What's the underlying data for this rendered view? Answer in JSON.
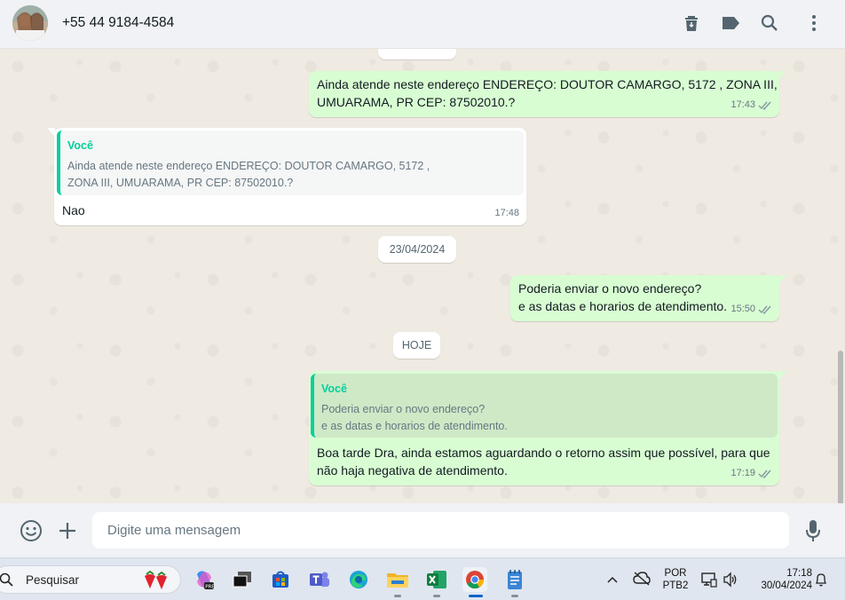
{
  "header": {
    "contact_name": "+55 44 9184-4584",
    "icons": [
      "delete-icon",
      "label-icon",
      "search-icon",
      "menu-icon"
    ]
  },
  "messages": {
    "msg1": {
      "text_line1": "Ainda atende neste endereço ENDEREÇO: DOUTOR CAMARGO, 5172 , ZONA III,",
      "text_line2": "UMUARAMA, PR CEP: 87502010.?",
      "time": "17:43"
    },
    "msg2": {
      "quote_author": "Você",
      "quote_line1": "Ainda atende neste endereço ENDEREÇO: DOUTOR CAMARGO, 5172 ,",
      "quote_line2": "ZONA III, UMUARAMA, PR CEP: 87502010.?",
      "text": "Nao",
      "time": "17:48"
    },
    "date1": "23/04/2024",
    "msg3": {
      "text_line1": "Poderia enviar o novo endereço?",
      "text_line2": "e as datas e horarios de atendimento.",
      "time": "15:50"
    },
    "date2": "HOJE",
    "msg4": {
      "quote_author": "Você",
      "quote_line1": "Poderia enviar o novo endereço?",
      "quote_line2": "e as datas e horarios de atendimento.",
      "text_line1": "Boa tarde Dra, ainda estamos aguardando o retorno assim que possível, para que",
      "text_line2": "não haja negativa de atendimento.",
      "time": "17:19"
    }
  },
  "composer": {
    "placeholder": "Digite uma mensagem"
  },
  "taskbar": {
    "search_label": "Pesquisar",
    "language_line1": "POR",
    "language_line2": "PTB2",
    "time": "17:18",
    "date": "30/04/2024"
  },
  "colors": {
    "outgoing_bubble": "#d9fdd3",
    "incoming_bubble": "#ffffff",
    "accent": "#06cf9c",
    "tick": "#8696a0"
  }
}
